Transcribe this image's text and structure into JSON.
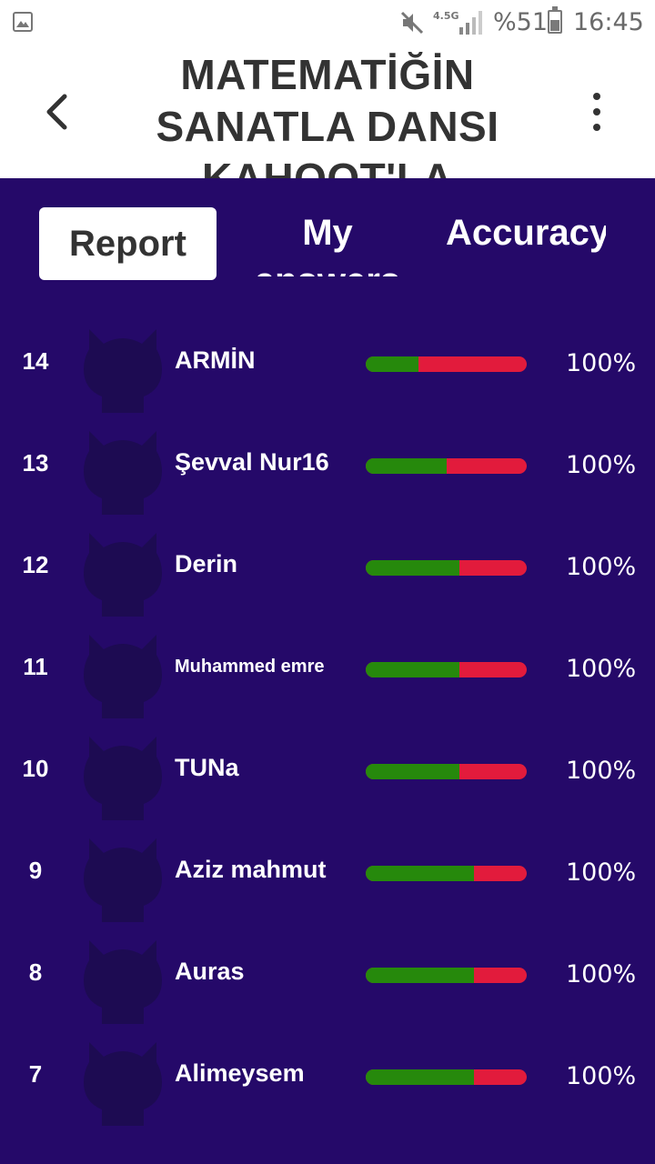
{
  "status_bar": {
    "network": "4.5G",
    "battery_percent": "%51",
    "time": "16:45"
  },
  "header": {
    "title": "MATEMATİĞİN SANATLA DANSI KAHOOT'LA"
  },
  "tabs": [
    {
      "label": "Report",
      "active": true
    },
    {
      "label": "My answers",
      "active": false
    },
    {
      "label": "Accuracy",
      "active": false
    }
  ],
  "players": [
    {
      "rank": "14",
      "name": "ARMİN",
      "accuracy": "100%",
      "correct_ratio": 0.33
    },
    {
      "rank": "13",
      "name": "Şevval Nur16",
      "accuracy": "100%",
      "correct_ratio": 0.5
    },
    {
      "rank": "12",
      "name": "Derin",
      "accuracy": "100%",
      "correct_ratio": 0.58
    },
    {
      "rank": "11",
      "name": "Muhammed emre",
      "accuracy": "100%",
      "correct_ratio": 0.58
    },
    {
      "rank": "10",
      "name": "TUNa",
      "accuracy": "100%",
      "correct_ratio": 0.58
    },
    {
      "rank": "9",
      "name": "Aziz mahmut",
      "accuracy": "100%",
      "correct_ratio": 0.67
    },
    {
      "rank": "8",
      "name": "Auras",
      "accuracy": "100%",
      "correct_ratio": 0.67
    },
    {
      "rank": "7",
      "name": "Alimeysem",
      "accuracy": "100%",
      "correct_ratio": 0.67
    }
  ],
  "colors": {
    "background": "#250969",
    "correct": "#26890c",
    "incorrect": "#e21b3c",
    "avatar": "#1d0b52"
  }
}
